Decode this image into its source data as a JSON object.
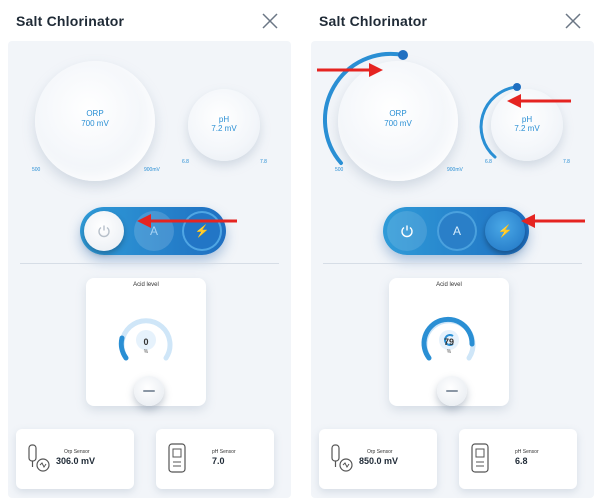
{
  "screens": [
    {
      "title": "Salt Chlorinator",
      "orp": {
        "label": "ORP",
        "value": "700 mV",
        "min": "500",
        "max": "900mV",
        "level": 0
      },
      "ph": {
        "label": "pH",
        "value": "7.2 mV",
        "min": "6.8",
        "max": "7.8",
        "level": 0
      },
      "acid": {
        "title": "Acid level",
        "value": "0",
        "unit": "%",
        "level": 0.1
      },
      "orp_sensor": {
        "label": "Orp Sensor",
        "value": "306.0 mV"
      },
      "ph_sensor": {
        "label": "pH Sensor",
        "value": "7.0"
      }
    },
    {
      "title": "Salt Chlorinator",
      "orp": {
        "label": "ORP",
        "value": "700 mV",
        "min": "500",
        "max": "900mV",
        "level": 0.5
      },
      "ph": {
        "label": "pH",
        "value": "7.2 mV",
        "min": "6.8",
        "max": "7.8",
        "level": 0.4
      },
      "acid": {
        "title": "Acid level",
        "value": "79",
        "unit": "%",
        "level": 0.79
      },
      "orp_sensor": {
        "label": "Orp Sensor",
        "value": "850.0 mV"
      },
      "ph_sensor": {
        "label": "pH Sensor",
        "value": "6.8"
      }
    }
  ],
  "colors": {
    "accent": "#2a8fd4",
    "accent_dark": "#1f6fc1",
    "annotation": "#e52421"
  },
  "icons": [
    "close-icon",
    "power-icon",
    "auto-icon",
    "boost-icon",
    "orp-sensor-icon",
    "ph-sensor-icon",
    "minus-icon"
  ]
}
